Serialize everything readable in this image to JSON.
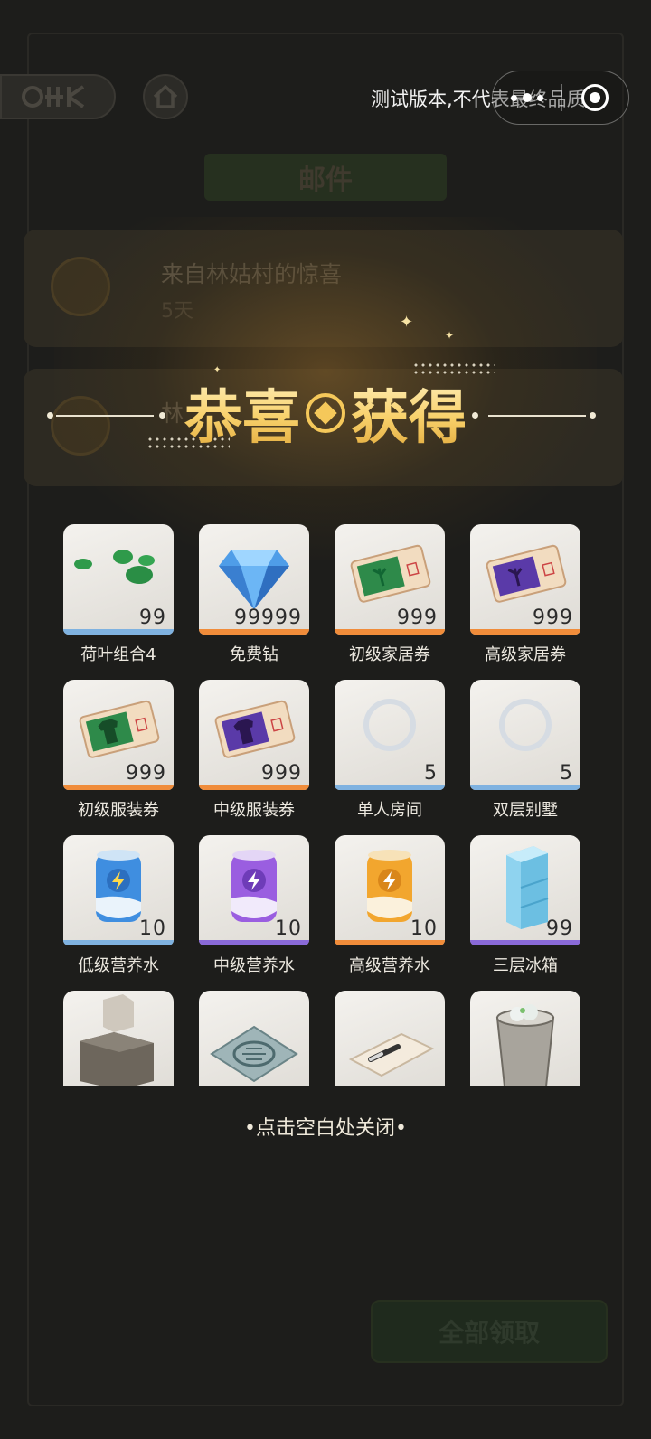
{
  "background": {
    "mail_title": "邮件",
    "mails": [
      {
        "title": "来自林姑村的惊喜",
        "days": "5天"
      },
      {
        "title": "林",
        "days": ""
      }
    ],
    "claim_all": "全部领取"
  },
  "watermark": "测试版本,不代表最终品质",
  "reward_popup": {
    "title_left": "恭喜",
    "title_right": "获得",
    "close_hint": "•点击空白处关闭•",
    "items": [
      {
        "name": "荷叶组合4",
        "qty": "99",
        "icon": "lotus-leaf-icon",
        "rarity": "blue"
      },
      {
        "name": "免费钻",
        "qty": "99999",
        "icon": "diamond-icon",
        "rarity": "orange"
      },
      {
        "name": "初级家居券",
        "qty": "999",
        "icon": "green-home-ticket-icon",
        "rarity": "orange"
      },
      {
        "name": "高级家居券",
        "qty": "999",
        "icon": "purple-home-ticket-icon",
        "rarity": "orange"
      },
      {
        "name": "初级服装券",
        "qty": "999",
        "icon": "green-clothing-ticket-icon",
        "rarity": "orange"
      },
      {
        "name": "中级服装券",
        "qty": "999",
        "icon": "purple-clothing-ticket-icon",
        "rarity": "orange"
      },
      {
        "name": "单人房间",
        "qty": "5",
        "icon": "room-placeholder-icon",
        "rarity": "blue"
      },
      {
        "name": "双层别墅",
        "qty": "5",
        "icon": "villa-placeholder-icon",
        "rarity": "blue"
      },
      {
        "name": "低级营养水",
        "qty": "10",
        "icon": "blue-can-icon",
        "rarity": "blue"
      },
      {
        "name": "中级营养水",
        "qty": "10",
        "icon": "purple-can-icon",
        "rarity": "purple"
      },
      {
        "name": "高级营养水",
        "qty": "10",
        "icon": "orange-can-icon",
        "rarity": "orange"
      },
      {
        "name": "三层冰箱",
        "qty": "99",
        "icon": "fridge-icon",
        "rarity": "purple"
      },
      {
        "name": "",
        "qty": "",
        "icon": "range-hood-icon",
        "rarity": "blue"
      },
      {
        "name": "",
        "qty": "",
        "icon": "floor-drain-icon",
        "rarity": "blue"
      },
      {
        "name": "",
        "qty": "",
        "icon": "cutting-board-icon",
        "rarity": "blue"
      },
      {
        "name": "",
        "qty": "",
        "icon": "trash-bin-icon",
        "rarity": "blue"
      }
    ]
  },
  "colors": {
    "blue": "#7fb2e0",
    "orange": "#f08c3a",
    "purple": "#8a6ad8",
    "gold": "#f5c85a"
  }
}
